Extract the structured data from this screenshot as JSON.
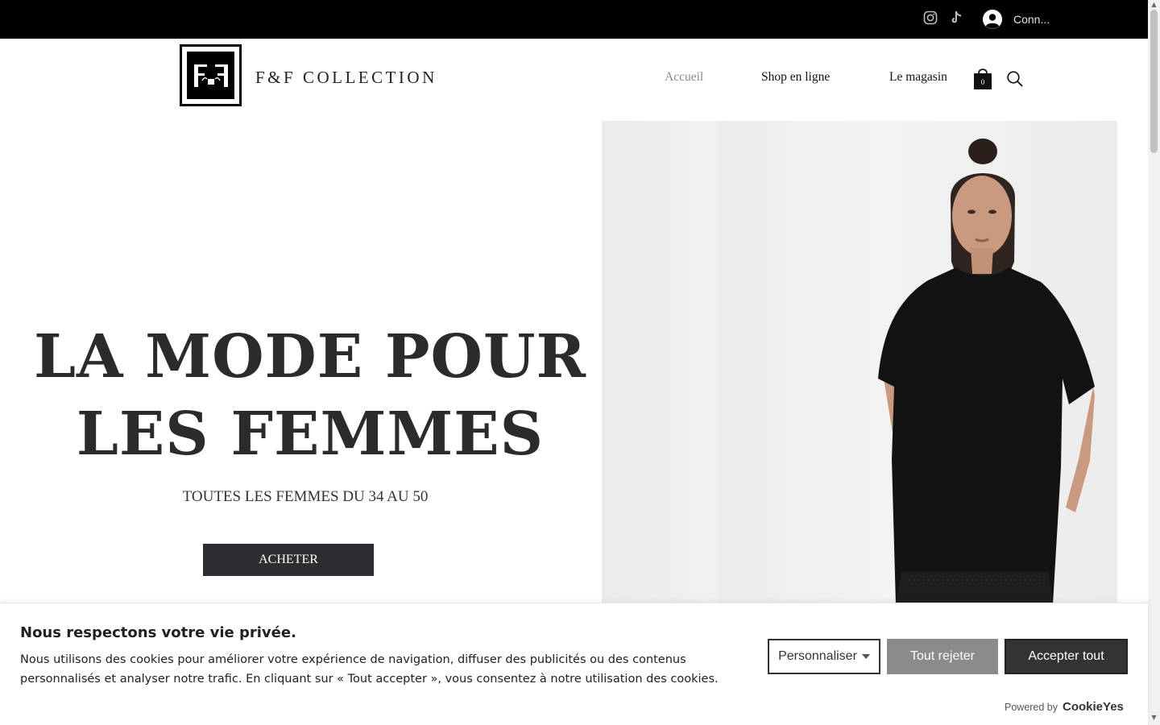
{
  "topbar": {
    "social": [
      {
        "icon": "instagram-icon"
      },
      {
        "icon": "tiktok-icon"
      }
    ],
    "login_label": "Conn..."
  },
  "header": {
    "brand": "F&F COLLECTION",
    "nav": [
      {
        "label": "Accueil",
        "active": true
      },
      {
        "label": "Shop en ligne",
        "active": false
      },
      {
        "label": "Le magasin",
        "active": false
      }
    ],
    "cart_count": "0"
  },
  "hero": {
    "title_line1": "LA MODE POUR",
    "title_line2": "LES FEMMES",
    "subtitle": "TOUTES LES FEMMES DU 34 AU 50",
    "button_label": "ACHETER"
  },
  "cookie": {
    "title": "Nous respectons votre vie privée.",
    "text": "Nous utilisons des cookies pour améliorer votre expérience de navigation, diffuser des publicités ou des contenus personnalisés et analyser notre trafic. En cliquant sur « Tout accepter », vous consentez à notre utilisation des cookies.",
    "customize_label": "Personnaliser",
    "reject_label": "Tout rejeter",
    "accept_label": "Accepter tout",
    "powered_label": "Powered by",
    "powered_brand": "CookieYes"
  },
  "colors": {
    "topbar": "#000000",
    "button_dark": "#2d2e31",
    "reject_gray": "#8b8b8b",
    "nav_active": "#8a8a8a"
  }
}
